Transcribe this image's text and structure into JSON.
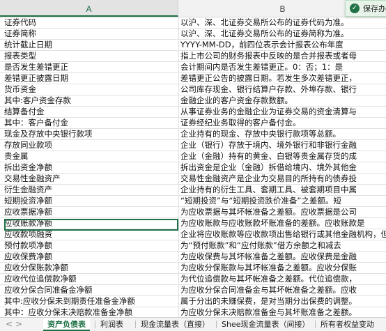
{
  "columns": {
    "a": "A",
    "b": "B"
  },
  "toast": {
    "text": "保存办"
  },
  "rows": [
    {
      "a": "证券代码",
      "b": "以沪、深、北证券交易所公布的证券代码为准。"
    },
    {
      "a": "证券简称",
      "b": "以沪、深、北证券交易所公布的证券简称为准。"
    },
    {
      "a": "统计截止日期",
      "b": "YYYY-MM-DD，前四位表示会计报表公布年度"
    },
    {
      "a": "报表类型",
      "b": "指上市公司的财务报表中反映的是合并报表或者母"
    },
    {
      "a": "是否发生差错更正",
      "b": "会计期间内是否发生差错更正。0：否；1：是"
    },
    {
      "a": "差错更正披露日期",
      "b": "差错更正公告的披露日期。若发生多次差错更正，"
    },
    {
      "a": "货币资金",
      "b": "公司库存现金、银行结算户存款、外埠存款、银行"
    },
    {
      "a": "其中:客户资金存款",
      "b": "金融企业的客户资金存款数额。"
    },
    {
      "a": "结算备付金",
      "b": "从事证券业务的金融企业为证券交易的资金清算与"
    },
    {
      "a": "其中：客户备付金",
      "b": "证券经纪业务取得的客户备付金。"
    },
    {
      "a": "现金及存放中央银行款项",
      "b": "企业持有的现金、存放中央银行款项等总额。"
    },
    {
      "a": "存放同业款项",
      "b": "企业（银行）存放于境内、境外银行和非银行金融"
    },
    {
      "a": "贵金属",
      "b": "企业（金融）持有的黄金、白银等贵金属存货的成"
    },
    {
      "a": "拆出资金净额",
      "b": "拆出资金是企业（金融）拆借给境内、境外其他金"
    },
    {
      "a": "交易性金融资产",
      "b": "交易性金融资产是企业为交易目的所持有的债券投"
    },
    {
      "a": "衍生金融资产",
      "b": "企业持有的衍生工具、套期工具、被套期项目中属"
    },
    {
      "a": "短期投资净额",
      "b": "“短期投资”与“短期投资跌价准备”之差额。短"
    },
    {
      "a": "应收票据净额",
      "b": "为应收票据与其坏帐准备之差额。应收票据是公司"
    },
    {
      "a": "应收账款净额",
      "b": "为应收账款与应收账款坏账准备的差额。应收账款是"
    },
    {
      "a": "应收款项融资",
      "b": "企业将应收账款等应收款项出售给银行或其他金融机构，但是"
    },
    {
      "a": "预付款项净额",
      "b": "为“预付账款”和“应付账款”借方余额之和减去"
    },
    {
      "a": "应收保费净额",
      "b": "为应收保费与其坏帐准备之差额。应收保费是金融"
    },
    {
      "a": "应收分保账款净额",
      "b": "为应收分保账款与其坏帐准备之差额。应收分保账"
    },
    {
      "a": "应收代位追偿款净额",
      "b": "为代位追偿款与其坏帐准备之差额。代位追偿款，"
    },
    {
      "a": "应收分保合同准备金净额",
      "b": "为应收分保合同准备金与其坏帐准备之差额。应收"
    },
    {
      "a": "其中:应收分保未到期责任准备金净额",
      "b": "属于分出的未赚保费，是对当期分出保费的调整。"
    },
    {
      "a": "其中：应收分保未决赔款准备金净额",
      "b": "为应收分保未决赔款准备金与其坏账准备之差额。"
    }
  ],
  "tabs": [
    "资产负债表",
    "利润表",
    "现金流量表（直接）",
    "Shee现金流量表（间接）",
    "所有者权益变动"
  ],
  "active_tab": 0,
  "nav": {
    "prev": "<",
    "next": ">"
  }
}
